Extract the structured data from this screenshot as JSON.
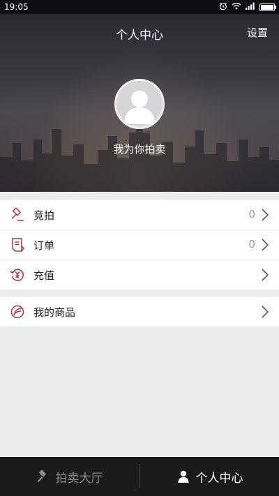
{
  "status_bar": {
    "time": "19:05",
    "icons": [
      "alarm-icon",
      "wifi-icon",
      "signal-icon",
      "battery-icon"
    ]
  },
  "header": {
    "title": "个人中心",
    "settings_label": "设置"
  },
  "profile": {
    "avatar_icon": "avatar-placeholder-icon",
    "username": "我为你拍卖"
  },
  "menu": {
    "group1": [
      {
        "icon": "gavel-icon",
        "label": "竞拍",
        "count": "0"
      },
      {
        "icon": "order-icon",
        "label": "订单",
        "count": "0"
      },
      {
        "icon": "recharge-icon",
        "label": "充值",
        "count": ""
      }
    ],
    "group2": [
      {
        "icon": "my-goods-icon",
        "label": "我的商品",
        "count": ""
      }
    ]
  },
  "tabbar": {
    "tabs": [
      {
        "label": "拍卖大厅",
        "icon": "gavel-icon",
        "active": false
      },
      {
        "label": "个人中心",
        "icon": "person-icon",
        "active": true
      }
    ]
  },
  "colors": {
    "accent_red": "#b8323a",
    "tabbar_bg": "#1b1b1b",
    "page_bg": "#ececec"
  }
}
